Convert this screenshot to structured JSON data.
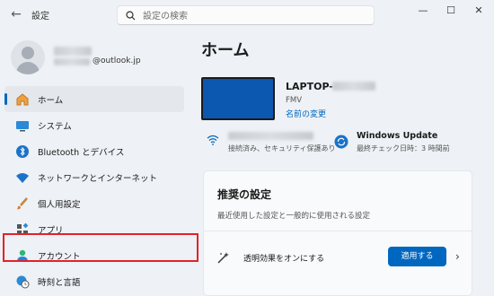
{
  "window": {
    "title": "設定"
  },
  "search": {
    "placeholder": "設定の検索"
  },
  "profile": {
    "email_suffix": "@outlook.jp"
  },
  "sidebar": {
    "items": [
      {
        "label": "ホーム",
        "icon": "home-icon",
        "active": true
      },
      {
        "label": "システム",
        "icon": "system-icon"
      },
      {
        "label": "Bluetooth とデバイス",
        "icon": "bluetooth-icon"
      },
      {
        "label": "ネットワークとインターネット",
        "icon": "wifi-icon"
      },
      {
        "label": "個人用設定",
        "icon": "brush-icon"
      },
      {
        "label": "アプリ",
        "icon": "apps-icon"
      },
      {
        "label": "アカウント",
        "icon": "account-icon",
        "highlighted": true
      },
      {
        "label": "時刻と言語",
        "icon": "globe-clock-icon"
      }
    ]
  },
  "main": {
    "title": "ホーム",
    "device": {
      "name": "LAPTOP-",
      "model": "FMV",
      "rename_link": "名前の変更"
    },
    "network": {
      "status": "接続済み、セキュリティ保護あり"
    },
    "windows_update": {
      "title": "Windows Update",
      "last_check": "最終チェック日時：3 時間前"
    },
    "recommended": {
      "title": "推奨の設定",
      "description": "最近使用した設定と一般的に使用される設定",
      "row_label": "透明効果をオンにする",
      "apply_button": "適用する"
    }
  },
  "colors": {
    "accent": "#0067c0",
    "highlight_border": "#e3222b"
  }
}
